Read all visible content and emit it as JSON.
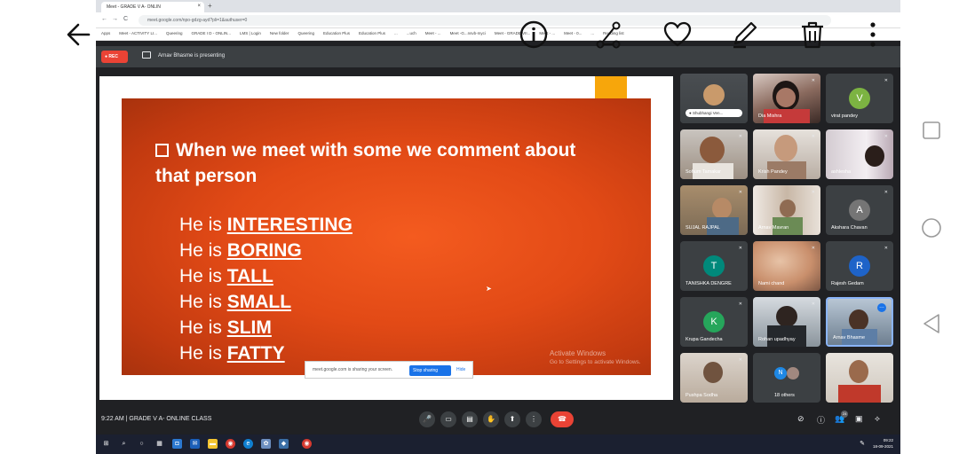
{
  "browser": {
    "tab_title": "Meet - GRADE V A- ONLIN",
    "url": "meet.google.com/npo-gdzg-ayd?pli=1&authuser=0",
    "bookmarks": [
      "Apps",
      "Meet - ACTIVITY LI...",
      "Queering",
      "GRADE I D - ONLIN...",
      "LMS | Login",
      "New folder",
      "Queering",
      "Education Plus",
      "Education Plus",
      "...",
      "...uch",
      "Meet - ...",
      "Meet -G...nsvb-myci",
      "Meet - GRADE VII...",
      "Meet - ...",
      "Meet - 0...",
      "...",
      "Reading list"
    ]
  },
  "meet_top": {
    "rec_label": "REC",
    "presenting_text": "Arnav Bhasme is presenting"
  },
  "slide": {
    "question": "When we meet with some we comment about that person",
    "lines": [
      {
        "prefix": "He is",
        "word": "INTERESTING"
      },
      {
        "prefix": "He is",
        "word": "BORING"
      },
      {
        "prefix": "He is",
        "word": "TALL"
      },
      {
        "prefix": "He is",
        "word": "SMALL"
      },
      {
        "prefix": "He is",
        "word": "SLIM"
      },
      {
        "prefix": "He is",
        "word": "FATTY"
      }
    ],
    "watermark_title": "Activate Windows",
    "watermark_sub": "Go to Settings to activate Windows.",
    "share_text": "meet.google.com is sharing your screen.",
    "stop_sharing": "Stop sharing",
    "hide": "Hide"
  },
  "participants": [
    {
      "name": "Shubhangi Ven...",
      "kind": "photo"
    },
    {
      "name": "Dia Mishra",
      "kind": "photo"
    },
    {
      "name": "virat pandey",
      "kind": "avatar",
      "initial": "V",
      "color": "#7cb342"
    },
    {
      "name": "Sohum Tamakar",
      "kind": "photo"
    },
    {
      "name": "Krish Pandey",
      "kind": "photo"
    },
    {
      "name": "ashlesha",
      "kind": "photo"
    },
    {
      "name": "SUJAL RAJPAL",
      "kind": "photo"
    },
    {
      "name": "Arnav Mavran",
      "kind": "photo"
    },
    {
      "name": "Akshara Chavan",
      "kind": "avatar",
      "initial": "A",
      "color": "#757575"
    },
    {
      "name": "TANISHKA DENGRE",
      "kind": "avatar",
      "initial": "T",
      "color": "#00897b"
    },
    {
      "name": "Nami chand",
      "kind": "photo"
    },
    {
      "name": "Rajesh Gedam",
      "kind": "avatar",
      "initial": "R",
      "color": "#1e63c8"
    },
    {
      "name": "Krupa Gandecha",
      "kind": "avatar",
      "initial": "K",
      "color": "#26a65b"
    },
    {
      "name": "Rohan upadhyay",
      "kind": "photo"
    },
    {
      "name": "Arnav Bhasme",
      "kind": "photo"
    },
    {
      "name": "Pushpa Sodha",
      "kind": "photo"
    },
    {
      "name": "18 others",
      "kind": "others",
      "initial": "N"
    },
    {
      "name": "",
      "kind": "photo"
    }
  ],
  "bottom": {
    "time": "9:22 AM",
    "separator": "|",
    "meeting_name": "GRADE V A- ONLINE CLASS",
    "people_count": "24"
  },
  "taskbar": {
    "clock": "09:22",
    "date": "18-09-2021"
  },
  "colors": {
    "slide_orange": "#e24a16",
    "accent_tab": "#f7a60b",
    "meet_bg": "#202124",
    "hangup": "#ea4335"
  }
}
